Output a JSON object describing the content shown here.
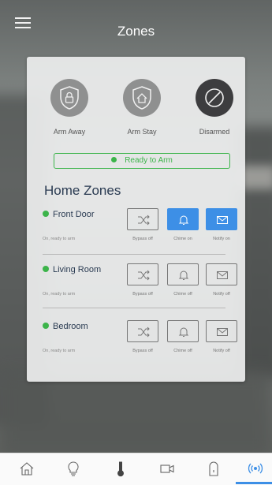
{
  "header": {
    "title": "Zones"
  },
  "modes": [
    {
      "label": "Arm Away",
      "icon": "shield-lock-icon",
      "active": false
    },
    {
      "label": "Arm Stay",
      "icon": "shield-home-icon",
      "active": false
    },
    {
      "label": "Disarmed",
      "icon": "disarm-slash-icon",
      "active": true
    }
  ],
  "ready_banner": {
    "text": "Ready to Arm"
  },
  "zones_title": "Home Zones",
  "zones": [
    {
      "name": "Front Door",
      "status": "On, ready to arm",
      "bypass": "Bypass off",
      "chime": "Chime on",
      "notify": "Notify on"
    },
    {
      "name": "Living Room",
      "status": "On, ready to arm",
      "bypass": "Bypass off",
      "chime": "Chime off",
      "notify": "Notify off"
    },
    {
      "name": "Bedroom",
      "status": "On, ready to arm",
      "bypass": "Bypass off",
      "chime": "Chime off",
      "notify": "Notify off"
    }
  ],
  "tabs": [
    "home-icon",
    "lightbulb-icon",
    "thermometer-icon",
    "video-camera-icon",
    "lock-icon",
    "sensors-icon"
  ],
  "colors": {
    "accent": "#3d8fe6",
    "ready_green": "#3cb44a",
    "title_navy": "#2a3b52"
  }
}
